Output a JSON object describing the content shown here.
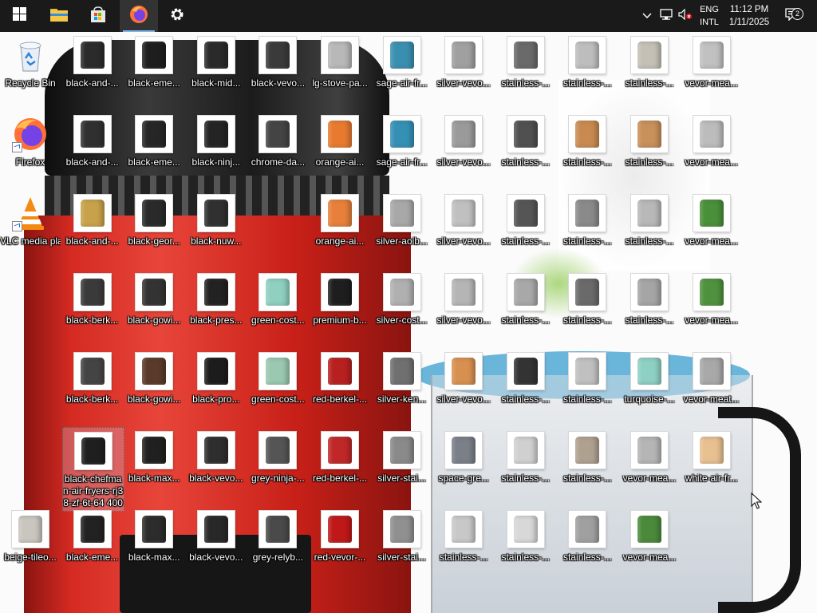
{
  "taskbar": {
    "start_icon": "windows-logo-icon",
    "pinned": [
      {
        "name": "file-explorer-icon",
        "active": false
      },
      {
        "name": "microsoft-store-icon",
        "active": false
      },
      {
        "name": "firefox-icon",
        "active": true
      },
      {
        "name": "settings-gear-icon",
        "active": false
      }
    ],
    "tray": {
      "icons": [
        "chevron-up-icon",
        "network-icon",
        "volume-muted-icon"
      ],
      "language_line1": "ENG",
      "language_line2": "INTL",
      "time": "11:12 PM",
      "date": "1/11/2025",
      "notification_count": "2"
    }
  },
  "desktop": {
    "icons": [
      {
        "label": "Recycle Bin",
        "kind": "recycle",
        "col": 0,
        "row": 0
      },
      {
        "label": "Firefox",
        "kind": "firefox",
        "col": 0,
        "row": 1
      },
      {
        "label": "VLC media player",
        "kind": "vlc",
        "col": 0,
        "row": 2
      },
      {
        "label": "beige-tileo...",
        "kind": "thumb",
        "color": "#c9c5bf",
        "col": 0,
        "row": 6
      },
      {
        "label": "black-and-...",
        "kind": "thumb",
        "color": "#2b2b2b",
        "col": 1,
        "row": 0
      },
      {
        "label": "black-and-...",
        "kind": "thumb",
        "color": "#303030",
        "col": 1,
        "row": 1
      },
      {
        "label": "black-and-...",
        "kind": "thumb",
        "color": "#c8a24a",
        "col": 1,
        "row": 2
      },
      {
        "label": "black-berk...",
        "kind": "thumb",
        "color": "#3a3a3a",
        "col": 1,
        "row": 3
      },
      {
        "label": "black-berk...",
        "kind": "thumb",
        "color": "#444444",
        "col": 1,
        "row": 4
      },
      {
        "label": "black-chefman-air-fryers-rj38-zf-6t-64 400",
        "kind": "thumb",
        "color": "#1f1f1f",
        "col": 1,
        "row": 5,
        "selected": true
      },
      {
        "label": "black-eme...",
        "kind": "thumb",
        "color": "#222222",
        "col": 1,
        "row": 6
      },
      {
        "label": "black-eme...",
        "kind": "thumb",
        "color": "#1e1e1e",
        "col": 2,
        "row": 0
      },
      {
        "label": "black-eme...",
        "kind": "thumb",
        "color": "#262626",
        "col": 2,
        "row": 1
      },
      {
        "label": "black-geor...",
        "kind": "thumb",
        "color": "#2a2a2a",
        "col": 2,
        "row": 2
      },
      {
        "label": "black-gowi...",
        "kind": "thumb",
        "color": "#333333",
        "col": 2,
        "row": 3
      },
      {
        "label": "black-gowi...",
        "kind": "thumb",
        "color": "#5a3a2a",
        "col": 2,
        "row": 4
      },
      {
        "label": "black-max...",
        "kind": "thumb",
        "color": "#202020",
        "col": 2,
        "row": 5
      },
      {
        "label": "black-max...",
        "kind": "thumb",
        "color": "#2c2c2c",
        "col": 2,
        "row": 6
      },
      {
        "label": "black-mid...",
        "kind": "thumb",
        "color": "#2a2a2a",
        "col": 3,
        "row": 0
      },
      {
        "label": "black-ninj...",
        "kind": "thumb",
        "color": "#242424",
        "col": 3,
        "row": 1
      },
      {
        "label": "black-nuw...",
        "kind": "thumb",
        "color": "#303030",
        "col": 3,
        "row": 2
      },
      {
        "label": "black-pres...",
        "kind": "thumb",
        "color": "#222222",
        "col": 3,
        "row": 3
      },
      {
        "label": "black-pro...",
        "kind": "thumb",
        "color": "#1c1c1c",
        "col": 3,
        "row": 4
      },
      {
        "label": "black-vevo...",
        "kind": "thumb",
        "color": "#2e2e2e",
        "col": 3,
        "row": 5
      },
      {
        "label": "black-vevo...",
        "kind": "thumb",
        "color": "#282828",
        "col": 3,
        "row": 6
      },
      {
        "label": "black-vevo...",
        "kind": "thumb",
        "color": "#3a3a3a",
        "col": 4,
        "row": 0
      },
      {
        "label": "chrome-da...",
        "kind": "thumb",
        "color": "#444444",
        "col": 4,
        "row": 1
      },
      {
        "label": "green-cost...",
        "kind": "thumb",
        "color": "#8fd0c0",
        "col": 4,
        "row": 3
      },
      {
        "label": "green-cost...",
        "kind": "thumb",
        "color": "#9ac8b0",
        "col": 4,
        "row": 4
      },
      {
        "label": "grey-ninja-...",
        "kind": "thumb",
        "color": "#555555",
        "col": 4,
        "row": 5
      },
      {
        "label": "grey-relyb...",
        "kind": "thumb",
        "color": "#4a4a4a",
        "col": 4,
        "row": 6
      },
      {
        "label": "lg-stove-pa...",
        "kind": "thumb",
        "color": "#b8b8b8",
        "col": 5,
        "row": 0
      },
      {
        "label": "orange-ai...",
        "kind": "thumb",
        "color": "#e87a30",
        "col": 5,
        "row": 1
      },
      {
        "label": "orange-ai...",
        "kind": "thumb",
        "color": "#e8803a",
        "col": 5,
        "row": 2
      },
      {
        "label": "premium-b...",
        "kind": "thumb",
        "color": "#1e1e1e",
        "col": 5,
        "row": 3
      },
      {
        "label": "red-berkel-...",
        "kind": "thumb",
        "color": "#b82020",
        "col": 5,
        "row": 4
      },
      {
        "label": "red-berkel-...",
        "kind": "thumb",
        "color": "#c02828",
        "col": 5,
        "row": 5
      },
      {
        "label": "red-vevor-...",
        "kind": "thumb",
        "color": "#c01818",
        "col": 5,
        "row": 6
      },
      {
        "label": "sage-air-fr...",
        "kind": "thumb",
        "color": "#3a8fb0",
        "col": 6,
        "row": 0
      },
      {
        "label": "sage-air-fr...",
        "kind": "thumb",
        "color": "#3590b5",
        "col": 6,
        "row": 1
      },
      {
        "label": "silver-aoib...",
        "kind": "thumb",
        "color": "#a8a8a8",
        "col": 6,
        "row": 2
      },
      {
        "label": "silver-cost...",
        "kind": "thumb",
        "color": "#b0b0b0",
        "col": 6,
        "row": 3
      },
      {
        "label": "silver-ken...",
        "kind": "thumb",
        "color": "#707070",
        "col": 6,
        "row": 4
      },
      {
        "label": "silver-stai...",
        "kind": "thumb",
        "color": "#8a8a8a",
        "col": 6,
        "row": 5
      },
      {
        "label": "silver-stai...",
        "kind": "thumb",
        "color": "#909090",
        "col": 6,
        "row": 6
      },
      {
        "label": "silver-vevo...",
        "kind": "thumb",
        "color": "#a0a0a0",
        "col": 7,
        "row": 0
      },
      {
        "label": "silver-vevo...",
        "kind": "thumb",
        "color": "#9a9a9a",
        "col": 7,
        "row": 1
      },
      {
        "label": "silver-vevo...",
        "kind": "thumb",
        "color": "#c0c0c0",
        "col": 7,
        "row": 2
      },
      {
        "label": "silver-vevo...",
        "kind": "thumb",
        "color": "#b5b5b5",
        "col": 7,
        "row": 3
      },
      {
        "label": "silver-vevo...",
        "kind": "thumb",
        "color": "#d89050",
        "col": 7,
        "row": 4
      },
      {
        "label": "space-gre...",
        "kind": "thumb",
        "color": "#7a7f88",
        "col": 7,
        "row": 5
      },
      {
        "label": "stainless-...",
        "kind": "thumb",
        "color": "#c8c8c8",
        "col": 7,
        "row": 6
      },
      {
        "label": "stainless-...",
        "kind": "thumb",
        "color": "#6a6a6a",
        "col": 8,
        "row": 0
      },
      {
        "label": "stainless-...",
        "kind": "thumb",
        "color": "#505050",
        "col": 8,
        "row": 1
      },
      {
        "label": "stainless-...",
        "kind": "thumb",
        "color": "#555555",
        "col": 8,
        "row": 2
      },
      {
        "label": "stainless-...",
        "kind": "thumb",
        "color": "#a8a8a8",
        "col": 8,
        "row": 3
      },
      {
        "label": "stainless-...",
        "kind": "thumb",
        "color": "#333333",
        "col": 8,
        "row": 4
      },
      {
        "label": "stainless-...",
        "kind": "thumb",
        "color": "#d0d0d0",
        "col": 8,
        "row": 5
      },
      {
        "label": "stainless-...",
        "kind": "thumb",
        "color": "#d8d8d8",
        "col": 8,
        "row": 6
      },
      {
        "label": "stainless-...",
        "kind": "thumb",
        "color": "#bdbdbd",
        "col": 9,
        "row": 0
      },
      {
        "label": "stainless-...",
        "kind": "thumb",
        "color": "#c88a50",
        "col": 9,
        "row": 1
      },
      {
        "label": "stainless-...",
        "kind": "thumb",
        "color": "#8a8a8a",
        "col": 9,
        "row": 2
      },
      {
        "label": "stainless-...",
        "kind": "thumb",
        "color": "#6a6a6a",
        "col": 9,
        "row": 3
      },
      {
        "label": "stainless-...",
        "kind": "thumb",
        "color": "#c0c0c0",
        "col": 9,
        "row": 4
      },
      {
        "label": "stainless-...",
        "kind": "thumb",
        "color": "#b0a090",
        "col": 9,
        "row": 5
      },
      {
        "label": "stainless-...",
        "kind": "thumb",
        "color": "#a0a0a0",
        "col": 9,
        "row": 6
      },
      {
        "label": "stainless-...",
        "kind": "thumb",
        "color": "#c5c0b5",
        "col": 10,
        "row": 0
      },
      {
        "label": "stainless-...",
        "kind": "thumb",
        "color": "#c8905a",
        "col": 10,
        "row": 1
      },
      {
        "label": "stainless-...",
        "kind": "thumb",
        "color": "#b8b8b8",
        "col": 10,
        "row": 2
      },
      {
        "label": "stainless-...",
        "kind": "thumb",
        "color": "#a5a5a5",
        "col": 10,
        "row": 3
      },
      {
        "label": "turquoise-...",
        "kind": "thumb",
        "color": "#8ed0c4",
        "col": 10,
        "row": 4
      },
      {
        "label": "vevor-mea...",
        "kind": "thumb",
        "color": "#b5b5b5",
        "col": 10,
        "row": 5
      },
      {
        "label": "vevor-mea...",
        "kind": "thumb",
        "color": "#4a8a3a",
        "col": 10,
        "row": 6
      },
      {
        "label": "vevor-mea...",
        "kind": "thumb",
        "color": "#c0c0c0",
        "col": 11,
        "row": 0
      },
      {
        "label": "vevor-mea...",
        "kind": "thumb",
        "color": "#bcbcbc",
        "col": 11,
        "row": 1
      },
      {
        "label": "vevor-mea...",
        "kind": "thumb",
        "color": "#4a8f3a",
        "col": 11,
        "row": 2
      },
      {
        "label": "vevor-mea...",
        "kind": "thumb",
        "color": "#4f923e",
        "col": 11,
        "row": 3
      },
      {
        "label": "vevor-meat...",
        "kind": "thumb",
        "color": "#a8a8a8",
        "col": 11,
        "row": 4
      },
      {
        "label": "white-air-fr...",
        "kind": "thumb",
        "color": "#e8c090",
        "col": 11,
        "row": 5
      }
    ]
  },
  "colors": {
    "taskbar_bg": "#1a1a1a",
    "wallpaper_red": "#d42a22",
    "wallpaper_black": "#1c1c1c"
  }
}
